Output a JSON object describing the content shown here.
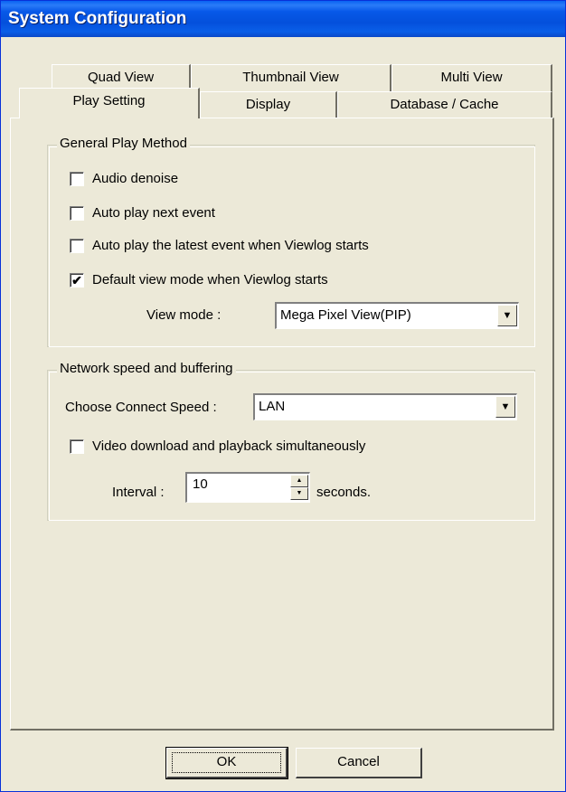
{
  "window": {
    "title": "System Configuration"
  },
  "tabs": {
    "row1": [
      "Quad View",
      "Thumbnail View",
      "Multi View"
    ],
    "row2": [
      "Play Setting",
      "Display",
      "Database / Cache"
    ],
    "active": "Play Setting"
  },
  "general": {
    "legend": "General Play Method",
    "options": [
      {
        "label": "Audio denoise",
        "checked": false
      },
      {
        "label": "Auto play next event",
        "checked": false
      },
      {
        "label": "Auto play the latest event when Viewlog starts",
        "checked": false
      },
      {
        "label": "Default view mode when Viewlog starts",
        "checked": true
      }
    ],
    "view_mode_label": "View mode :",
    "view_mode_value": "Mega Pixel View(PIP)"
  },
  "network": {
    "legend": "Network speed and buffering",
    "speed_label": "Choose Connect Speed :",
    "speed_value": "LAN",
    "simultaneous_label": "Video download and playback simultaneously",
    "simultaneous_checked": false,
    "interval_label": "Interval :",
    "interval_value": "10",
    "interval_unit": "seconds."
  },
  "buttons": {
    "ok": "OK",
    "cancel": "Cancel"
  }
}
